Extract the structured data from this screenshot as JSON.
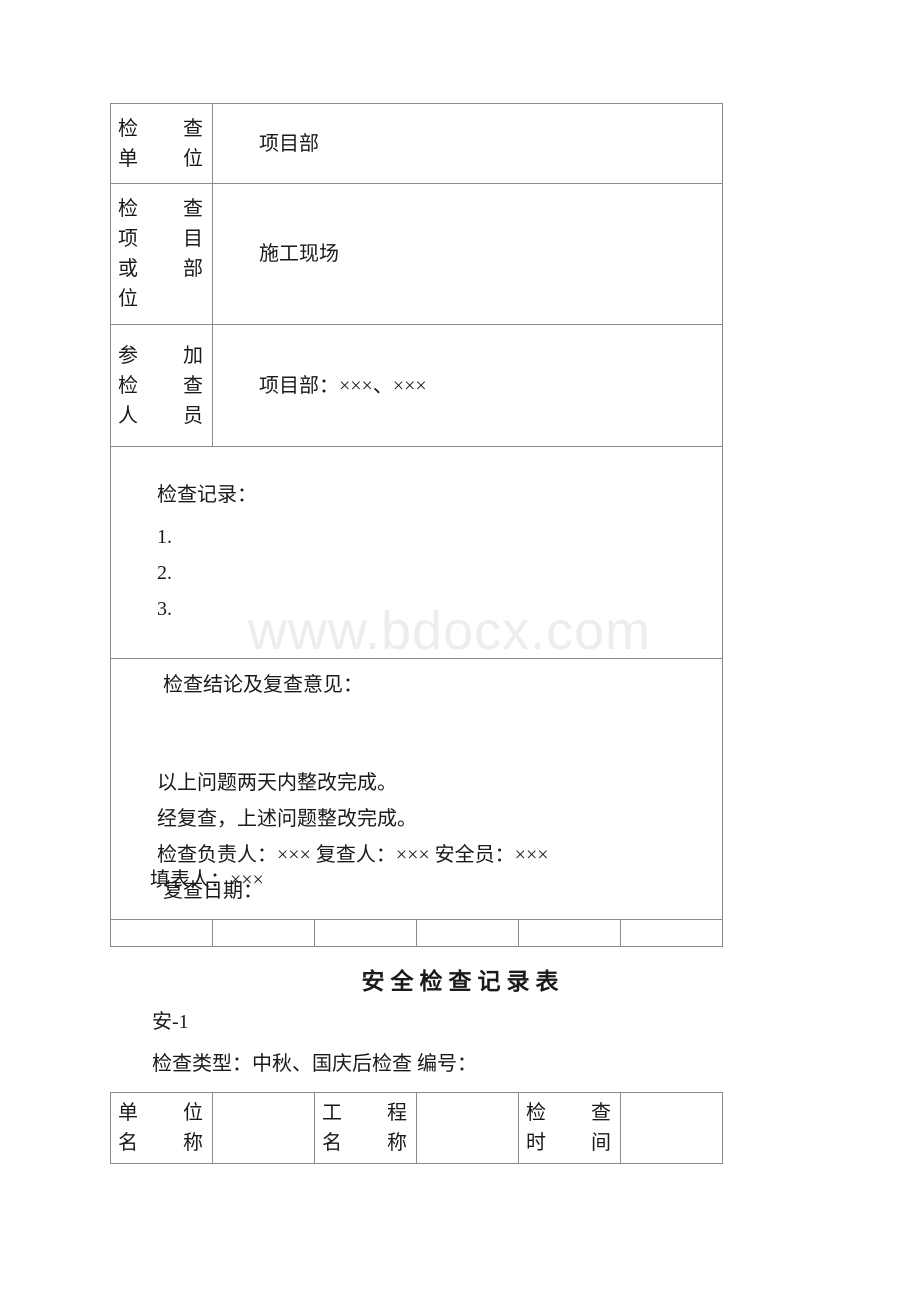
{
  "watermark": {
    "text": "www.bdocx.com"
  },
  "main_table": {
    "rows": [
      {
        "label": "检查单位",
        "label_lines": [
          "检查",
          "单位"
        ],
        "value": "项目部"
      },
      {
        "label": "检查项目或部位",
        "label_lines": [
          "检查",
          "项目",
          "或部",
          "位"
        ],
        "value": "施工现场"
      },
      {
        "label": "参加检查人员",
        "label_lines": [
          "参加",
          "检查",
          "人员"
        ],
        "value": "项目部：×××、×××"
      }
    ],
    "record_block": {
      "title": "检查记录：",
      "items": [
        "1.",
        "2.",
        "3."
      ]
    },
    "conclusion_block": {
      "title": "检查结论及复查意见：",
      "lines": [
        "以上问题两天内整改完成。",
        "经复查，上述问题整改完成。",
        "检查负责人：××× 复查人：××× 安全员：×××",
        "复查日期："
      ]
    },
    "footer_row_cells": [
      "",
      "",
      "",
      "",
      "",
      ""
    ]
  },
  "filler_line": "填表人：×××",
  "document": {
    "title": "安全检查记录表",
    "form_code": "安-1",
    "check_type_line": "检查类型：中秋、国庆后检查 编号："
  },
  "bottom_table": {
    "cells": [
      {
        "label_lines": [
          "单位",
          "名称"
        ],
        "value": ""
      },
      {
        "label_lines": [
          "工程",
          "名称"
        ],
        "value": ""
      },
      {
        "label_lines": [
          "检查",
          "时间"
        ],
        "value": ""
      }
    ]
  }
}
